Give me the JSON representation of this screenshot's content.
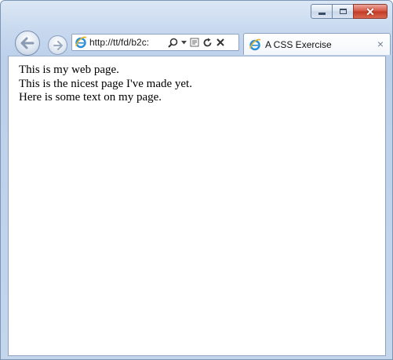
{
  "window": {
    "caption_buttons": {
      "minimize_icon": "minimize-icon",
      "maximize_icon": "maximize-icon",
      "close_icon": "close-icon",
      "close_color": "#c9452f"
    }
  },
  "navigation": {
    "back_icon": "back-arrow-icon",
    "forward_icon": "forward-arrow-icon"
  },
  "address_bar": {
    "url": "http://tt/fd/b2c:",
    "site_icon": "ie-logo-icon",
    "tools": [
      "search-icon",
      "dropdown-icon",
      "compatibility-view-icon",
      "refresh-icon",
      "stop-icon"
    ]
  },
  "tab": {
    "title": "A CSS Exercise",
    "icon": "ie-logo-icon",
    "close_label": "×"
  },
  "page": {
    "lines": [
      "This is my web page.",
      "This is the nicest page I've made yet.",
      "Here is some text on my page."
    ]
  }
}
